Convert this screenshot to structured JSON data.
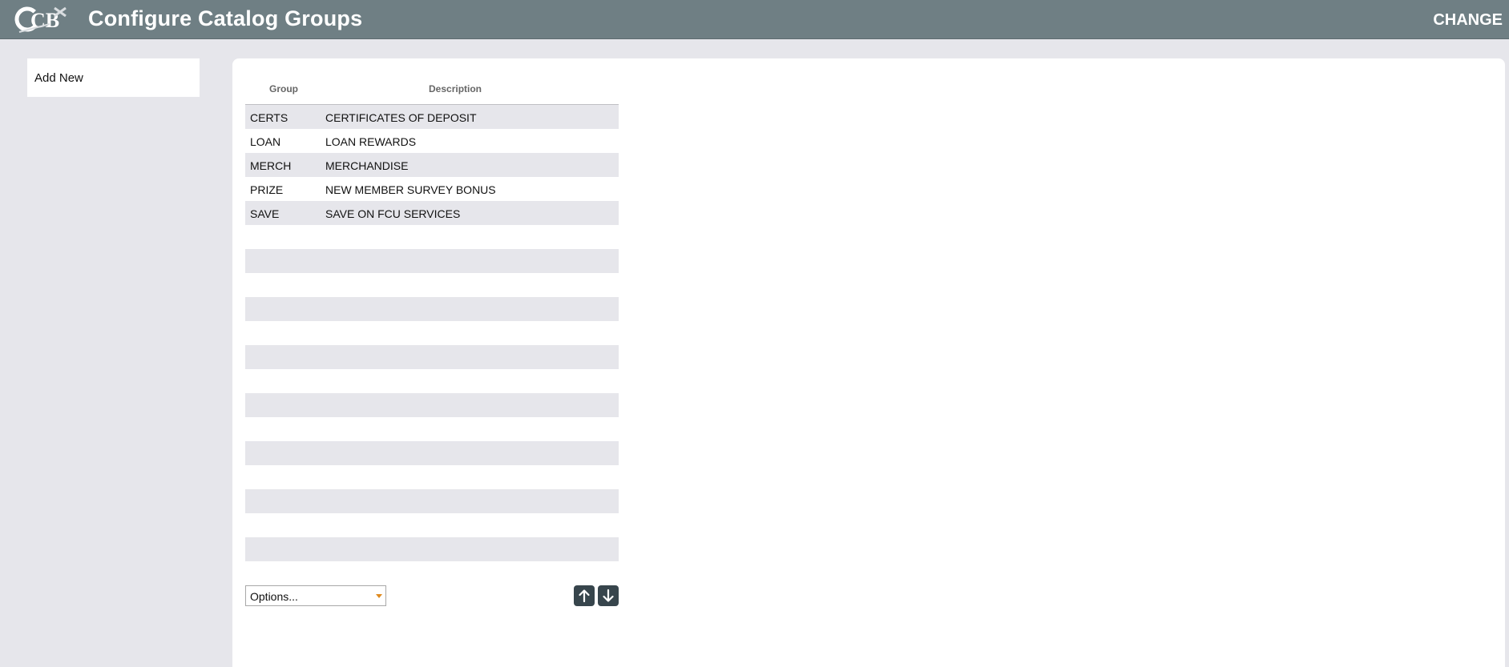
{
  "header": {
    "logo_text": "CB",
    "title": "Configure Catalog Groups",
    "change_label": "CHANGE",
    "bar_color": "#6f7f84"
  },
  "sidebar": {
    "add_new_label": "Add New"
  },
  "grid": {
    "columns": [
      "Group",
      "Description"
    ],
    "rows": [
      {
        "group": "CERTS",
        "description": "CERTIFICATES OF DEPOSIT"
      },
      {
        "group": "LOAN",
        "description": "LOAN REWARDS"
      },
      {
        "group": "MERCH",
        "description": "MERCHANDISE"
      },
      {
        "group": "PRIZE",
        "description": "NEW MEMBER SURVEY BONUS"
      },
      {
        "group": "SAVE",
        "description": "SAVE ON FCU SERVICES"
      }
    ]
  },
  "footer": {
    "options_label": "Options...",
    "move_up_icon": "arrow-up-icon",
    "move_down_icon": "arrow-down-icon",
    "button_color": "#37454c",
    "caret_color": "#e08a1e"
  }
}
